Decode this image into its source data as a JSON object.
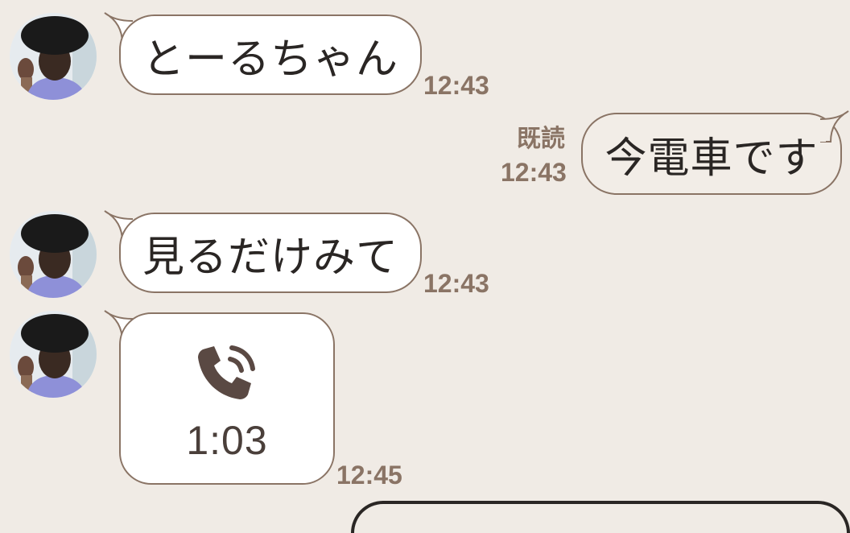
{
  "messages": [
    {
      "direction": "incoming",
      "text": "とーるちゃん",
      "time": "12:43"
    },
    {
      "direction": "outgoing",
      "text": "今電車です",
      "time": "12:43",
      "read_label": "既読"
    },
    {
      "direction": "incoming",
      "text": "見るだけみて",
      "time": "12:43"
    },
    {
      "direction": "incoming",
      "type": "call",
      "icon": "phone-call-icon",
      "duration": "1:03",
      "time": "12:45"
    }
  ],
  "colors": {
    "background": "#f0ebe5",
    "bubble_border": "#8a7465",
    "timestamp": "#8a7465",
    "call_icon": "#5a4943"
  }
}
